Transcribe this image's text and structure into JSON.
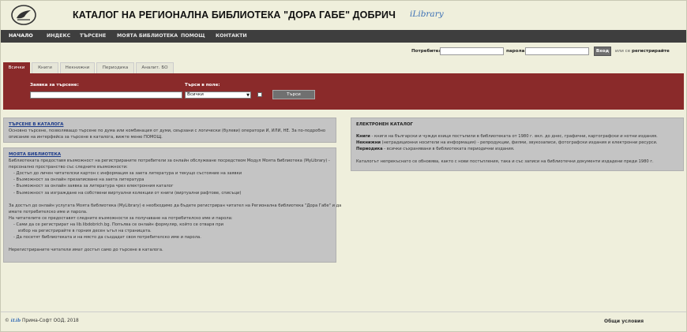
{
  "header": {
    "title": "КАТАЛОГ НА РЕГИОНАЛНА БИБЛИОТЕКА \"ДОРА ГАБЕ\" ДОБРИЧ",
    "brand": "iLibrary"
  },
  "nav": {
    "items": [
      "НАЧАЛО",
      "ИНДЕКС",
      "ТЪРСЕНЕ",
      "МОЯТА БИБЛИОТЕКА",
      "ПОМОЩ",
      "КОНТАКТИ"
    ]
  },
  "login": {
    "user_label": "Потребител:",
    "user_value": "",
    "password_label": "парола:",
    "password_value": "",
    "login_button": "Вход",
    "or_text": "или се",
    "register_link": "регистрирайте"
  },
  "tabs": [
    "Всички",
    "Книги",
    "Некнижни",
    "Периодика",
    "Аналит. БО"
  ],
  "search": {
    "query_label": "Заявка за търсене:",
    "query_value": "",
    "field_label": "Търси в поле:",
    "field_value": "Всички",
    "submit": "Търси"
  },
  "panel_search": {
    "head": "ТЪРСЕНЕ В КАТАЛОГА",
    "lines": [
      "Основно търсене, позволяващо търсене по дума или комбинация от думи, свързани с логически (булеви) оператори И, ИЛИ, НЕ. За по-подробно",
      "описание на интерфейса за търсене в каталога, вижте меню ПОМОЩ."
    ]
  },
  "panel_mylib": {
    "head": "МОЯТА БИБЛИОТЕКА",
    "lines": [
      "Библиотеката предоставя възможност на регистрираните потребители за онлайн обслужване посредством Модул Моята библиотека (MyLibrary) -",
      "персонално пространство със следните възможности:",
      "- Достъп до личен читателски картон с информация за заета литература и текущо състояние на заявки",
      "- Възможност за онлайн презаписване на заета литература",
      "- Възможност за онлайн заявка за литература чрез електронния каталог",
      "- Възможност за изграждане на собствени виртуални колекции от книги (виртуални рафтове, списъци)",
      "",
      "За достъп до онлайн услугата Моята библиотека (MyLibrary) е необходимо да бъдете регистриран читател на Регионална библиотека \"Дора Габе\" и да",
      "имате потребителско име и парола.",
      "На читателите се предоставят следните възможности за получаване на потребителско име и парола:",
      "- Сами да се регистрират на lib.libdobrich.bg. Попълва се онлайн формуляр, който се отваря при",
      "избор на регистрирайте в горния десен ъгъл на страницата.",
      "- Да посетят библиотеката и на място да създадат своя потребителско име и парола.",
      "",
      "Нерегистрираните читатели имат достъп само до търсене в каталога."
    ]
  },
  "panel_ecat": {
    "head": "ЕЛЕКТРОНЕН КАТАЛОГ",
    "books_bold": "Книги",
    "books_text": " - книги на български и чужди езици постъпили в библиотеката от 1980 г. вкл. до днес, графични, картографски и нотни издания.",
    "nonbook_bold": "Некнижни",
    "nonbook_text": " (нетрадиционни носители на информация) - репродукции, филми, звукозаписи, фотографски издания и електронни ресурси.",
    "periodic_bold": "Периодика",
    "periodic_text": " - всички съхранявани в библиотеката периодични издания.",
    "note": "Каталогът непрекъснато се обновява, както с нови постъпления, така и със записи на библиотечни документи издадени преди 1980 г."
  },
  "footer": {
    "copyright": "©",
    "brand": "iLib",
    "company": "Прима-Софт ООД, 2018",
    "terms": "Общи условия"
  },
  "colors": {
    "accent": "#8a2a2a",
    "nav_bg": "#3e3e3e",
    "page_bg": "#efefdc",
    "panel_bg": "#c4c4c4",
    "link": "#1a3a8a"
  }
}
